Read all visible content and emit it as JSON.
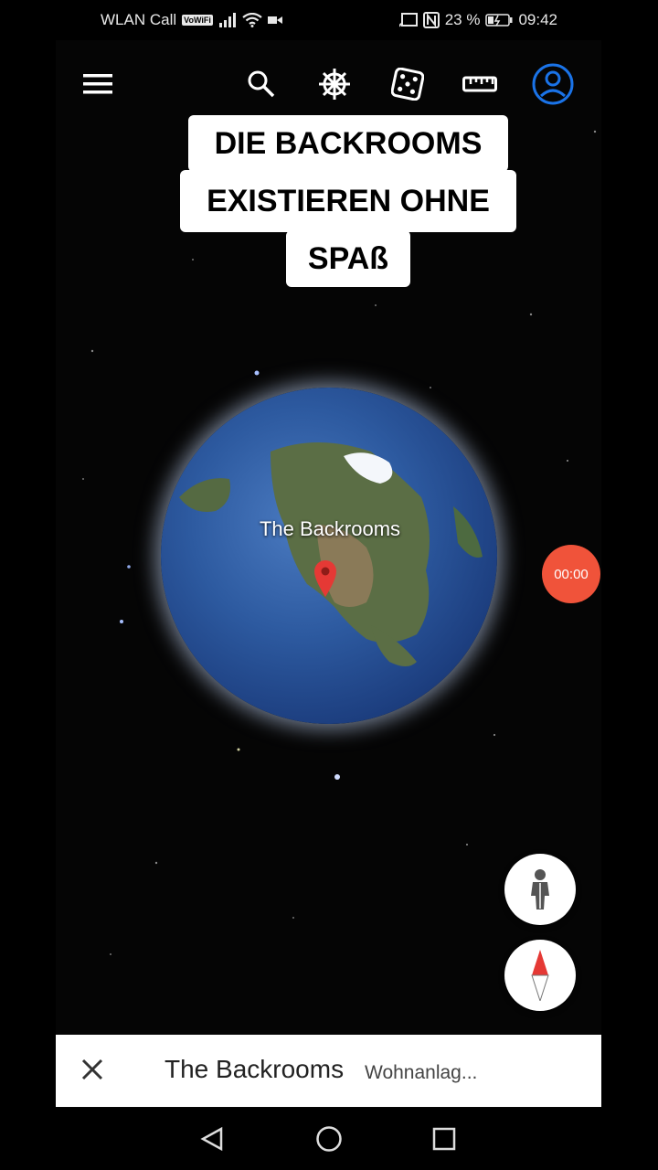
{
  "status_bar": {
    "carrier": "WLAN Call",
    "vowifi": "VoWiFi",
    "battery": "23 %",
    "time": "09:42"
  },
  "toolbar": {
    "icons": [
      "menu-icon",
      "search-icon",
      "voyager-helm-icon",
      "dice-icon",
      "ruler-icon",
      "account-icon"
    ]
  },
  "caption": {
    "line1": "DIE BACKROOMS",
    "line2": "EXISTIEREN OHNE",
    "line3": "SPAß"
  },
  "map": {
    "marker_label": "The Backrooms",
    "record_time": "00:00"
  },
  "bottom_card": {
    "title": "The Backrooms",
    "subtitle": "Wohnanlag..."
  },
  "colors": {
    "accent_blue": "#1a73e8",
    "record_red": "#f0533a",
    "pin_red": "#e53935"
  }
}
